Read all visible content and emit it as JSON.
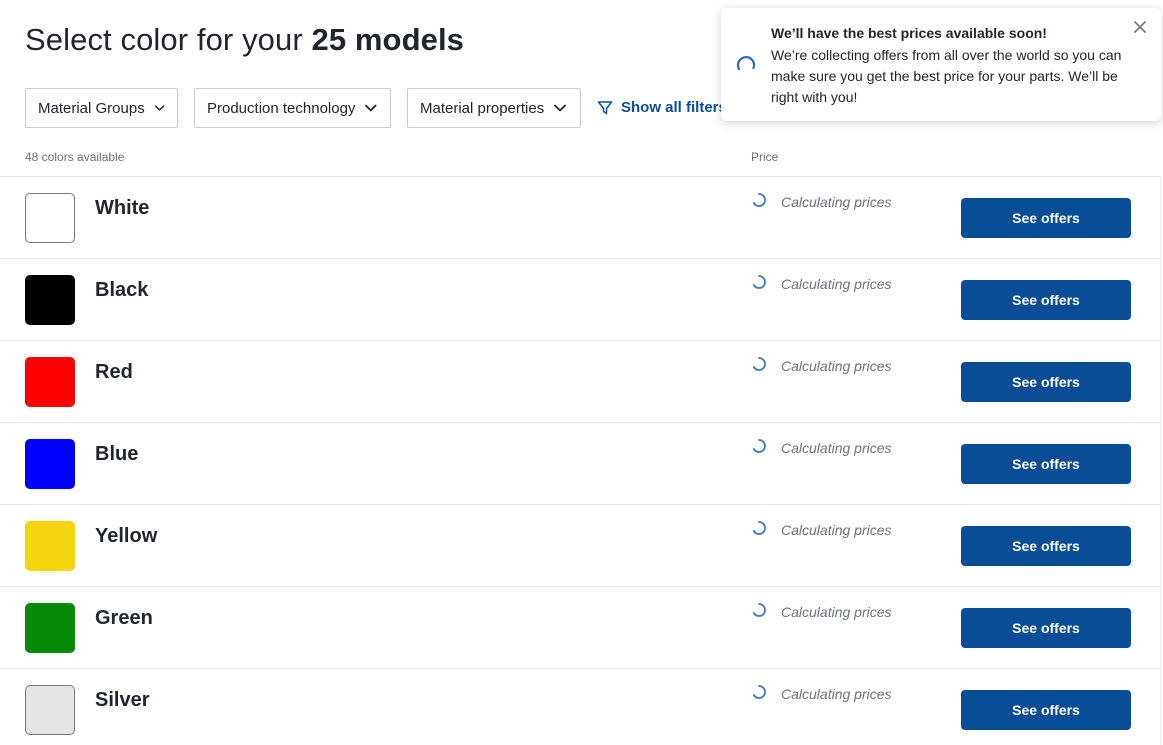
{
  "header": {
    "title_prefix": "Select color for your",
    "title_bold": "25 models"
  },
  "filters": [
    {
      "label": "Material Groups"
    },
    {
      "label": "Production technology"
    },
    {
      "label": "Material properties"
    }
  ],
  "show_all_filters": "Show all filters",
  "list_header": {
    "count": "48 colors available",
    "price": "Price"
  },
  "colors": [
    {
      "name": "White",
      "swatch": "#ffffff",
      "price_status": "Calculating prices",
      "button": "See offers"
    },
    {
      "name": "Black",
      "swatch": "#000000",
      "price_status": "Calculating prices",
      "button": "See offers"
    },
    {
      "name": "Red",
      "swatch": "#ff0000",
      "price_status": "Calculating prices",
      "button": "See offers"
    },
    {
      "name": "Blue",
      "swatch": "#0000ff",
      "price_status": "Calculating prices",
      "button": "See offers"
    },
    {
      "name": "Yellow",
      "swatch": "#f5d60e",
      "price_status": "Calculating prices",
      "button": "See offers"
    },
    {
      "name": "Green",
      "swatch": "#078a07",
      "price_status": "Calculating prices",
      "button": "See offers"
    },
    {
      "name": "Silver",
      "swatch": "#e4e5e4",
      "price_status": "Calculating prices",
      "button": "See offers"
    }
  ],
  "toast": {
    "title": "We’ll have the best prices available soon!",
    "body": "We’re collecting offers from all over the world so you can make sure you get the best price for your parts. We’ll be right with you!"
  },
  "theme": {
    "primary": "#0a4d97",
    "link": "#0b4f9e",
    "muted_text": "#6b7280"
  },
  "icons": {
    "dropdown": "chevron-down-icon",
    "filter": "filter-funnel-icon",
    "loading": "loading-spinner-icon",
    "close": "close-icon"
  }
}
